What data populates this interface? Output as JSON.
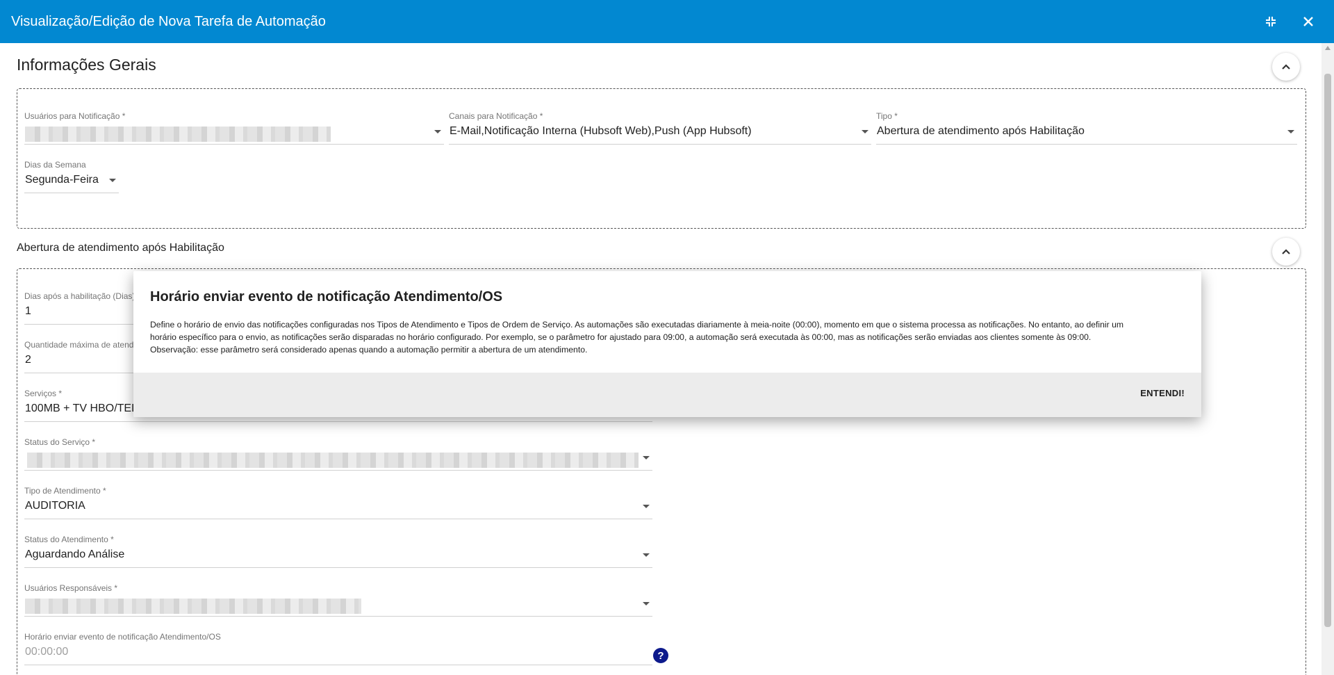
{
  "window": {
    "title": "Visualização/Edição de Nova Tarefa de Automação",
    "minimize_icon": "collapse-arrows-icon",
    "close_icon": "close-icon"
  },
  "general_section": {
    "title": "Informações Gerais",
    "fields": {
      "users_notification": {
        "label": "Usuários para Notificação *",
        "value": ""
      },
      "channels_notification": {
        "label": "Canais para Notificação *",
        "value": "E-Mail,Notificação Interna (Hubsoft Web),Push (App Hubsoft)"
      },
      "type": {
        "label": "Tipo *",
        "value": "Abertura de atendimento após Habilitação"
      },
      "weekdays": {
        "label": "Dias da Semana",
        "value": "Segunda-Feira"
      }
    }
  },
  "enablement_section": {
    "title": "Abertura de atendimento após Habilitação",
    "fields": {
      "days_after": {
        "label": "Dias após a habilitação (Dias)",
        "value": "1"
      },
      "max_quantity": {
        "label": "Quantidade máxima de atendi",
        "value": "2"
      },
      "services": {
        "label": "Serviços *",
        "value": "100MB + TV HBO/TEL"
      },
      "service_status": {
        "label": "Status do Serviço *",
        "value": ""
      },
      "ticket_type": {
        "label": "Tipo de Atendimento *",
        "value": "AUDITORIA"
      },
      "ticket_status": {
        "label": "Status do Atendimento *",
        "value": "Aguardando Análise"
      },
      "responsible_users": {
        "label": "Usuários Responsáveis *",
        "value": ""
      },
      "notify_time": {
        "label": "Horário enviar evento de notificação Atendimento/OS",
        "placeholder": "00:00:00"
      }
    }
  },
  "dialog": {
    "title": "Horário enviar evento de notificação Atendimento/OS",
    "body_line1": "Define o horário de envio das notificações configuradas nos Tipos de Atendimento e Tipos de Ordem de Serviço. As automações são executadas diariamente à meia-noite (00:00), momento em que o sistema processa as notificações. No entanto, ao definir um",
    "body_line2": "horário específico para o envio, as notificações serão disparadas no horário configurado. Por exemplo, se o parâmetro for ajustado para 09:00, a automação será executada às 00:00, mas as notificações serão enviadas aos clientes somente às 09:00.",
    "body_line3": "Observação: esse parâmetro será considerado apenas quando a automação permitir a abertura de um atendimento.",
    "button_label": "ENTENDI!"
  }
}
